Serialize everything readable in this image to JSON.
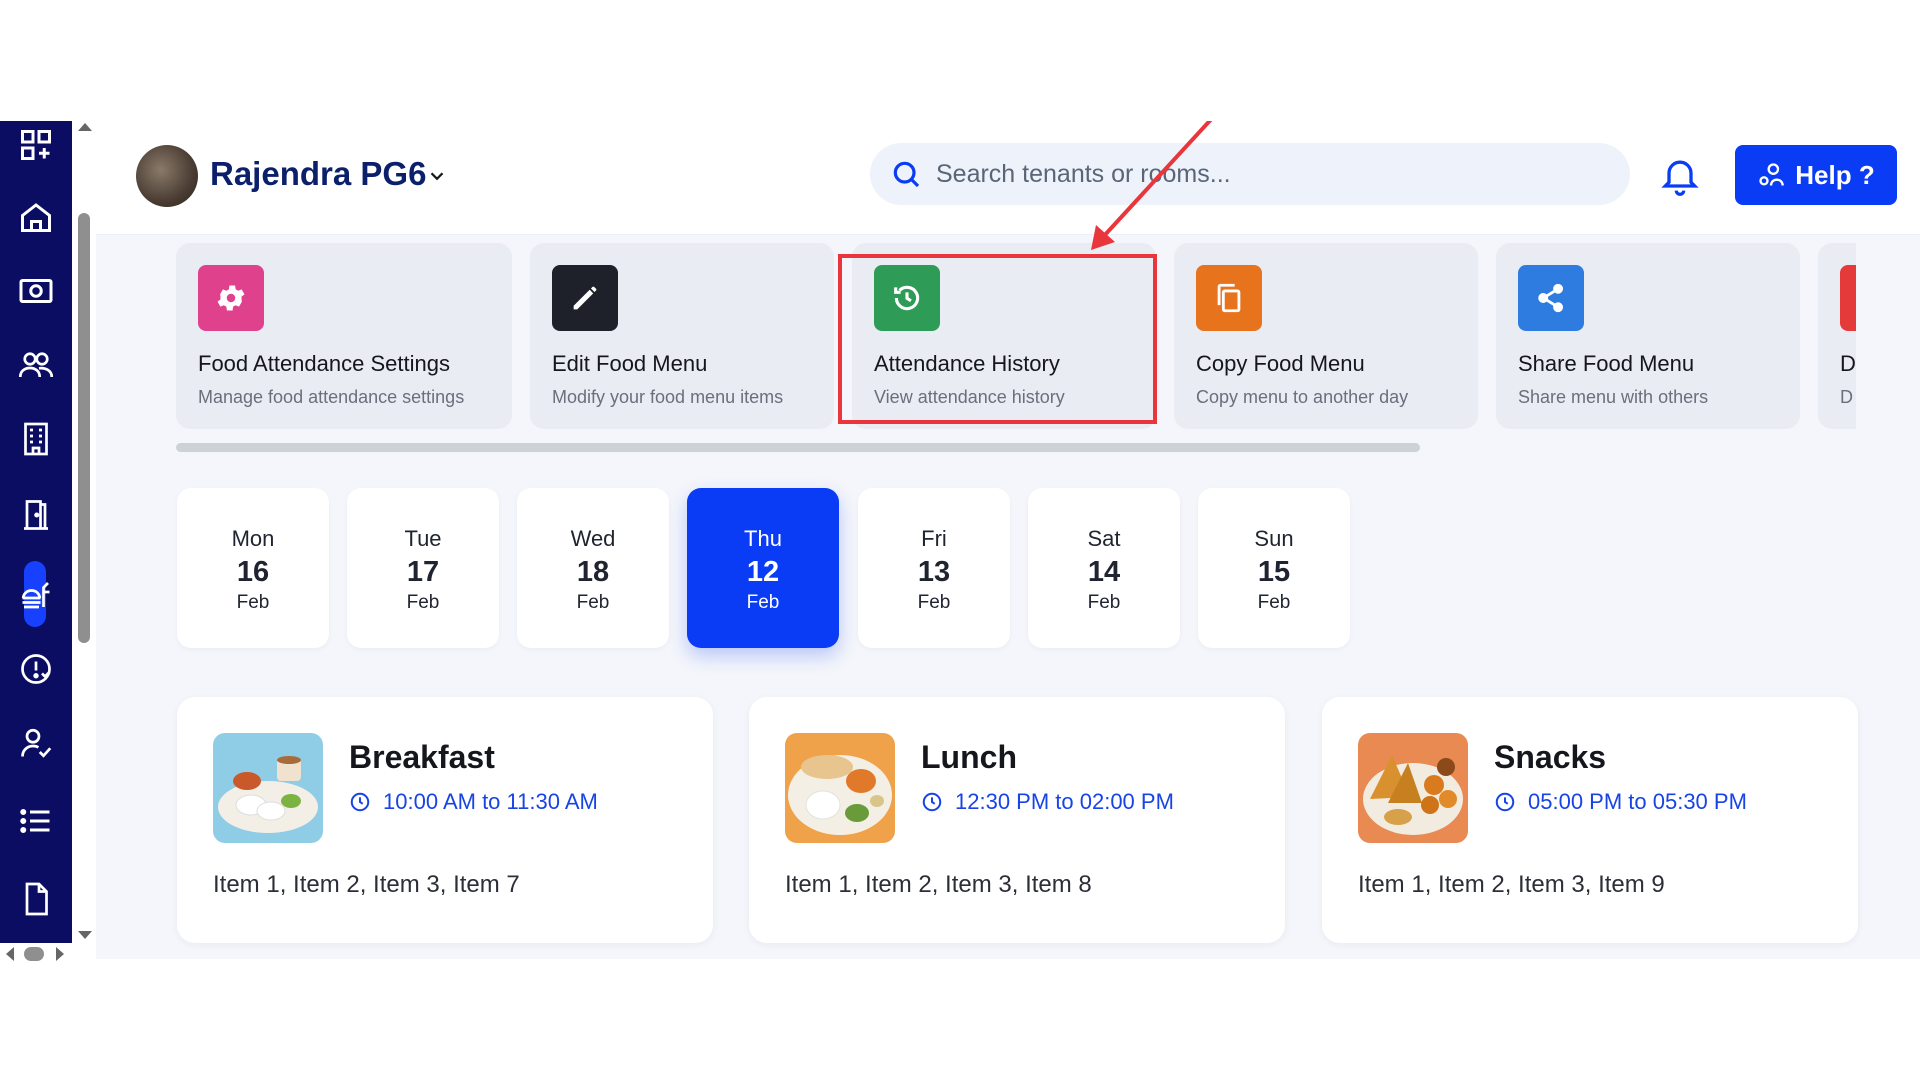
{
  "header": {
    "property_name": "Rajendra PG6",
    "search_placeholder": "Search tenants or rooms...",
    "help_label": "Help ?"
  },
  "sidebar": {
    "items": [
      {
        "icon": "dashboard-add-icon"
      },
      {
        "icon": "home-icon"
      },
      {
        "icon": "payments-icon"
      },
      {
        "icon": "tenants-icon"
      },
      {
        "icon": "building-icon"
      },
      {
        "icon": "rooms-door-icon"
      },
      {
        "icon": "food-menu-icon",
        "active": true
      },
      {
        "icon": "complaints-icon"
      },
      {
        "icon": "staff-icon"
      },
      {
        "icon": "list-icon"
      },
      {
        "icon": "document-icon"
      }
    ]
  },
  "actions": [
    {
      "title": "Food Attendance Settings",
      "subtitle": "Manage food attendance settings",
      "icon": "gear-icon",
      "color": "#e0418c"
    },
    {
      "title": "Edit Food Menu",
      "subtitle": "Modify your food menu items",
      "icon": "pencil-icon",
      "color": "#1e2129"
    },
    {
      "title": "Attendance History",
      "subtitle": "View attendance history",
      "icon": "history-icon",
      "color": "#2e9c57"
    },
    {
      "title": "Copy Food Menu",
      "subtitle": "Copy menu to another day",
      "icon": "copy-icon",
      "color": "#e8731d"
    },
    {
      "title": "Share Food Menu",
      "subtitle": "Share menu with others",
      "icon": "share-icon",
      "color": "#2e7ce0"
    },
    {
      "title": "D",
      "subtitle": "D",
      "icon": "",
      "color": "#e43a3a"
    }
  ],
  "days": [
    {
      "day": "Mon",
      "date": "16",
      "month": "Feb",
      "active": false
    },
    {
      "day": "Tue",
      "date": "17",
      "month": "Feb",
      "active": false
    },
    {
      "day": "Wed",
      "date": "18",
      "month": "Feb",
      "active": false
    },
    {
      "day": "Thu",
      "date": "12",
      "month": "Feb",
      "active": true
    },
    {
      "day": "Fri",
      "date": "13",
      "month": "Feb",
      "active": false
    },
    {
      "day": "Sat",
      "date": "14",
      "month": "Feb",
      "active": false
    },
    {
      "day": "Sun",
      "date": "15",
      "month": "Feb",
      "active": false
    }
  ],
  "meals": [
    {
      "name": "Breakfast",
      "time": "10:00 AM to 11:30 AM",
      "items": "Item 1, Item 2, Item 3, Item 7",
      "image": "breakfast-photo"
    },
    {
      "name": "Lunch",
      "time": "12:30 PM to 02:00 PM",
      "items": "Item 1, Item 2, Item 3, Item 8",
      "image": "lunch-photo"
    },
    {
      "name": "Snacks",
      "time": "05:00 PM to 05:30 PM",
      "items": "Item 1, Item 2, Item 3, Item 9",
      "image": "snacks-photo"
    }
  ],
  "colors": {
    "rail": "#0b0d63",
    "primary": "#0a3cf5",
    "highlight": "#e8363c"
  }
}
